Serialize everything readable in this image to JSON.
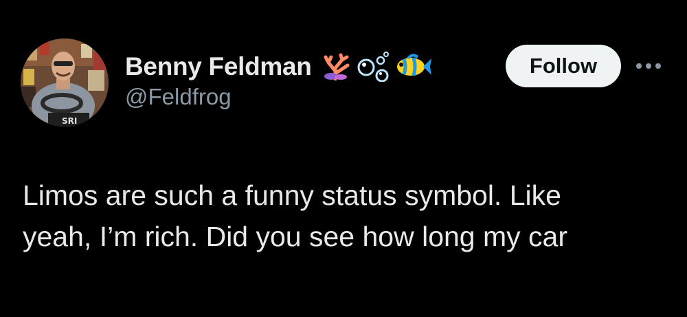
{
  "colors": {
    "background": "#000000",
    "primary_text": "#e7e9ea",
    "secondary_text": "#8b98a5",
    "follow_bg": "#eff3f4",
    "follow_text": "#0f1419"
  },
  "author": {
    "display_name": "Benny Feldman",
    "handle": "@Feldfrog",
    "name_emojis": [
      "coral-emoji",
      "bubbles-emoji",
      "tropical-fish-emoji"
    ],
    "avatar": "profile-photo"
  },
  "actions": {
    "follow_label": "Follow",
    "more_icon": "more-dots-icon"
  },
  "tweet": {
    "lines": [
      "Limos are such a funny status symbol. Like",
      "yeah, I’m rich. Did you see how long my car"
    ]
  }
}
